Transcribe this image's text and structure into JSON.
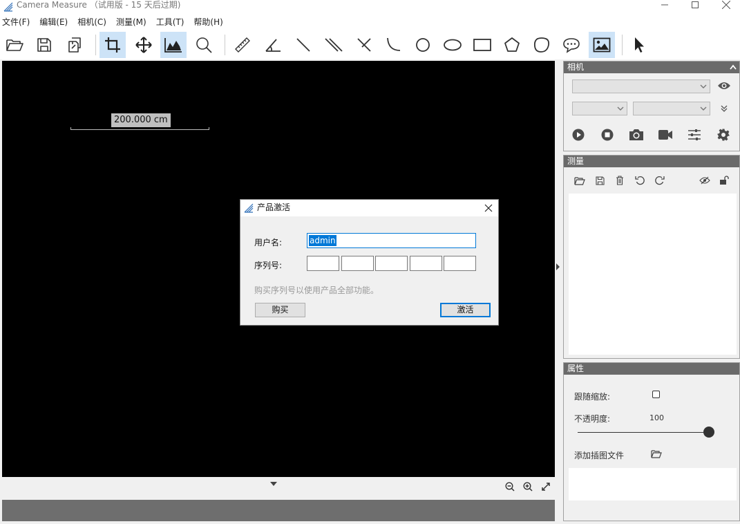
{
  "window": {
    "title": "Camera Measure （试用版 - 15 天后过期)"
  },
  "menu": [
    {
      "label": "文件(F)"
    },
    {
      "label": "编辑(E)"
    },
    {
      "label": "相机(C)"
    },
    {
      "label": "测量(M)"
    },
    {
      "label": "工具(T)"
    },
    {
      "label": "帮助(H)"
    }
  ],
  "toolbar": {
    "tools": [
      "open-folder",
      "save",
      "copy",
      "crop",
      "move",
      "histogram",
      "zoom",
      "ruler",
      "angle",
      "line",
      "parallel-lines",
      "perpendicular",
      "arc",
      "circle",
      "ellipse",
      "rectangle",
      "pentagon",
      "closed-curve",
      "annotation",
      "image-overlay",
      "pointer"
    ],
    "active": [
      "crop",
      "histogram",
      "image-overlay"
    ]
  },
  "canvas": {
    "scale_label": "200.000 cm",
    "background": "#000000"
  },
  "panels": {
    "camera": {
      "title": "相机"
    },
    "measure": {
      "title": "测量"
    },
    "properties": {
      "title": "属性",
      "follow_zoom_label": "跟随缩放:",
      "opacity_label": "不透明度:",
      "opacity_value": "100",
      "opacity_fraction": 1.0,
      "add_image_label": "添加插图文件"
    }
  },
  "dialog": {
    "title": "产品激活",
    "username_label": "用户名:",
    "username_value": "admin",
    "serial_label": "序列号:",
    "hint": "购买序列号以使用产品全部功能。",
    "buy_label": "购买",
    "activate_label": "激活"
  },
  "colors": {
    "accent": "#0078d7",
    "active_tool_bg": "#cde3f7",
    "panel_header": "#6a6a6a"
  }
}
